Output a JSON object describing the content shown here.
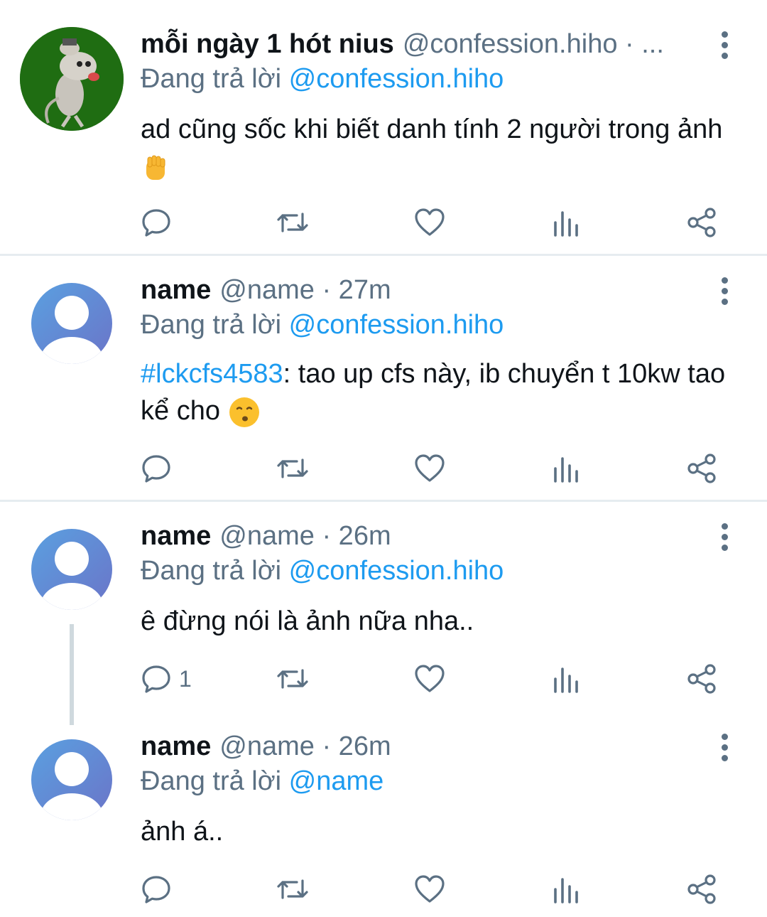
{
  "tweets": [
    {
      "display_name": "mỗi ngày 1 hót nius",
      "meta": "@confession.hiho · ...",
      "replying_prefix": "Đang trả lời",
      "replying_to": "@confession.hiho",
      "text": "ad cũng sốc khi biết danh tính 2 người trong ảnh",
      "reply_count": ""
    },
    {
      "display_name": "name",
      "meta": "@name · 27m",
      "replying_prefix": "Đang trả lời",
      "replying_to": "@confession.hiho",
      "hashtag": "#lckcfs4583",
      "text": ": tao up cfs này, ib chuyển t 10kw tao kể cho",
      "reply_count": ""
    },
    {
      "display_name": "name",
      "meta": "@name · 26m",
      "replying_prefix": "Đang trả lời",
      "replying_to": "@confession.hiho",
      "text": "ê đừng nói là ảnh nữa nha..",
      "reply_count": "1"
    },
    {
      "display_name": "name",
      "meta": "@name · 26m",
      "replying_prefix": "Đang trả lời",
      "replying_to": "@name",
      "text": "ảnh á..",
      "reply_count": ""
    }
  ],
  "icons": {
    "reply": "reply-icon",
    "retweet": "retweet-icon",
    "like": "heart-icon",
    "analytics": "analytics-icon",
    "share": "share-icon",
    "more": "more-vertical-icon"
  },
  "colors": {
    "link": "#1d9bf0",
    "secondary": "#5b7083",
    "divider": "#e6ecf0"
  }
}
